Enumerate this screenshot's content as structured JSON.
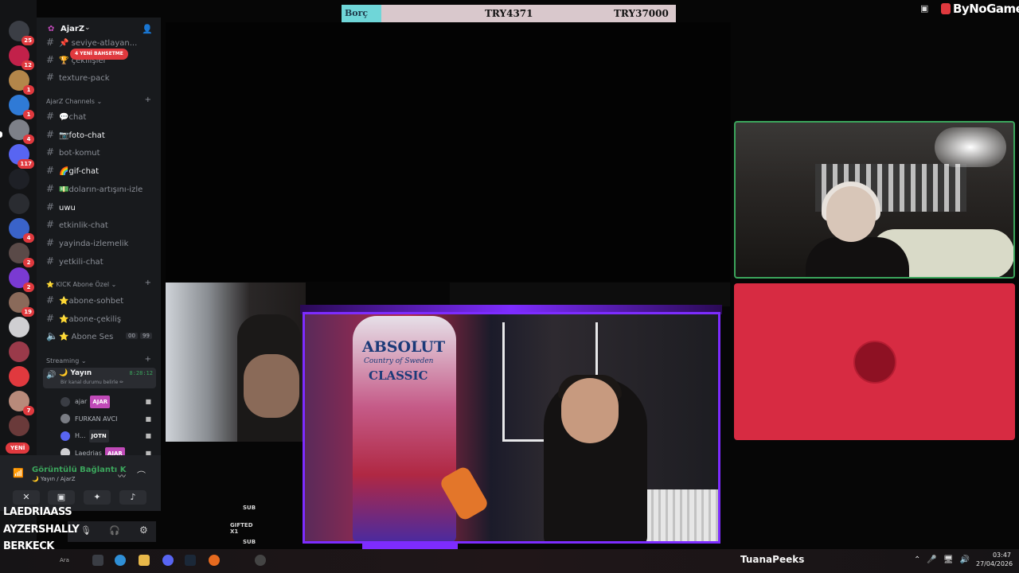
{
  "top_bar": {
    "debt_label": "Borç",
    "debt_current": "TRY4371",
    "debt_total": "TRY37000",
    "brand": "ByNoGame"
  },
  "rail": {
    "servers": [
      {
        "badge": "25",
        "color": "#3b3e45"
      },
      {
        "badge": "12",
        "color": "#c2214a"
      },
      {
        "badge": "1",
        "color": "#b3864a"
      },
      {
        "badge": "1",
        "color": "#2f7ad6"
      },
      {
        "badge": "4",
        "color": "#7d8088"
      },
      {
        "badge": "117",
        "color": "#5865f2"
      },
      {
        "badge": "",
        "color": "#1e2026"
      },
      {
        "badge": "",
        "color": "#2a2c31"
      },
      {
        "badge": "4",
        "color": "#3a63c9"
      },
      {
        "badge": "2",
        "color": "#5a4a48"
      },
      {
        "badge": "2",
        "color": "#7a3ad2"
      },
      {
        "badge": "19",
        "color": "#8a6a5a"
      },
      {
        "badge": "",
        "color": "#cfcfd2"
      },
      {
        "badge": "",
        "color": "#9a3a4a"
      },
      {
        "badge": "",
        "color": "#e0393e"
      },
      {
        "badge": "7",
        "color": "#b88a7a"
      },
      {
        "badge": "",
        "color": "#6a3a3a"
      }
    ],
    "new_label": "YENİ"
  },
  "channels": {
    "server_name": "AjarZ",
    "mention_pill": "4 YENİ BAHSETME",
    "top_items": [
      {
        "label": "📌 seviye-atlayan..."
      },
      {
        "label": "🏆 çekilişler"
      },
      {
        "label": "texture-pack"
      }
    ],
    "cat1": "AjarZ Channels",
    "list1": [
      {
        "label": "💬chat",
        "bold": false
      },
      {
        "label": "📷foto-chat",
        "bold": true
      },
      {
        "label": "bot-komut",
        "bold": false
      },
      {
        "label": "🌈gif-chat",
        "bold": true
      },
      {
        "label": "💵doların-artışını-izle",
        "bold": false
      },
      {
        "label": "uwu",
        "bold": true
      },
      {
        "label": "etkinlik-chat",
        "bold": false
      },
      {
        "label": "yayinda-izlemelik",
        "bold": false
      },
      {
        "label": "yetkili-chat",
        "bold": false
      }
    ],
    "cat2": "⭐ KICK Abone Özel",
    "list2": [
      {
        "label": "⭐abone-sohbet"
      },
      {
        "label": "⭐abone-çekiliş"
      },
      {
        "label": "⭐ Abone Ses"
      }
    ],
    "abone_ses_count": "00",
    "abone_ses_max": "99",
    "cat3": "Streaming",
    "voice_channel": "🌙 Yayın",
    "voice_timer": "8:28:12",
    "voice_status": "Bir kanal durumu belirle ✏",
    "voice_users": [
      {
        "name": "ajar",
        "tag": "AJAR",
        "tag_color": "#c04ab8"
      },
      {
        "name": "FURKAN AVCI",
        "tag": "",
        "tag_color": ""
      },
      {
        "name": "H...",
        "tag": "JOTN",
        "tag_color": "#2a2c31"
      },
      {
        "name": "Laedrias",
        "tag": "AJAR",
        "tag_color": "#c04ab8"
      }
    ]
  },
  "voice_panel": {
    "title": "Görüntülü Bağlantı K",
    "subtitle": "🌙 Yayın / AjarZ"
  },
  "subs": [
    {
      "name": "LAEDRIAASS",
      "type": "SUB"
    },
    {
      "name": "AYZERSHALLY",
      "type": "GIFTED X1"
    },
    {
      "name": "BERKECK",
      "type": "SUB"
    },
    {
      "name": "AYZERSHALLY",
      "type": "GIFTED X1"
    }
  ],
  "camera": {
    "bottle_brand": "ABSOLUT",
    "bottle_sub": "Country of Sweden",
    "bottle_line": "CLASSIC"
  },
  "taskbar": {
    "search": "Ara",
    "streamer": "TuanaPeeks",
    "time": "03:47",
    "date": "27/04/2026"
  }
}
